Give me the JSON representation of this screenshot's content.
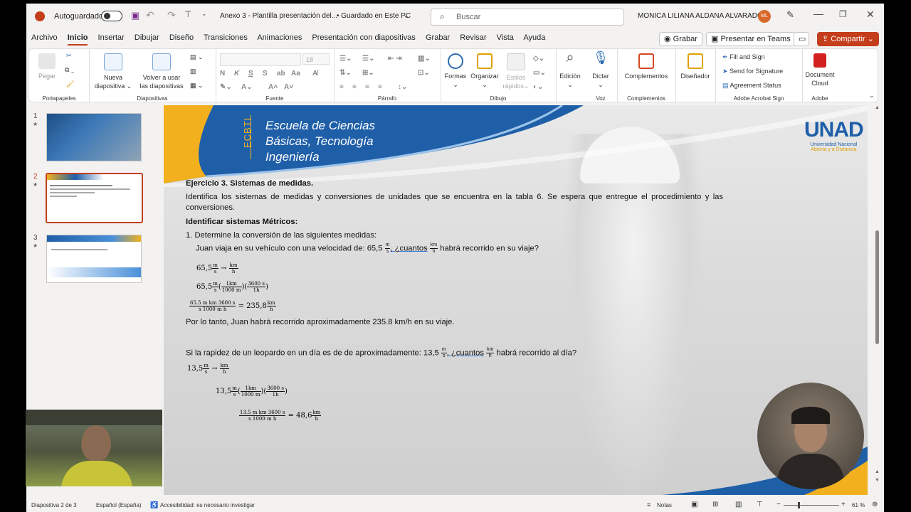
{
  "titlebar": {
    "autosave_label": "Autoguardado",
    "doc_title": "Anexo 3 - Plantilla presentación del...",
    "save_state": "• Guardado en Este PC",
    "search_placeholder": "Buscar",
    "user_name": "MONICA LILIANA ALDANA ALVARADO",
    "user_initials": "ML"
  },
  "menu": {
    "items": [
      "Archivo",
      "Inicio",
      "Insertar",
      "Dibujar",
      "Diseño",
      "Transiciones",
      "Animaciones",
      "Presentación con diapositivas",
      "Grabar",
      "Revisar",
      "Vista",
      "Ayuda"
    ],
    "record": "Grabar",
    "teams": "Presentar en Teams",
    "share": "Compartir"
  },
  "ribbon": {
    "paste": "Pegar",
    "new_slide": [
      "Nueva",
      "diapositiva"
    ],
    "reuse": [
      "Volver a usar",
      "las diapositivas"
    ],
    "font_size": "18",
    "shapes": "Formas",
    "arrange": "Organizar",
    "quick_styles": [
      "Estilos",
      "rápidos"
    ],
    "editing": "Edición",
    "dictate": "Dictar",
    "addins": "Complementos",
    "designer": "Diseñador",
    "fill_sign": "Fill and Sign",
    "send_sig": "Send for Signature",
    "agreement": "Agreement Status",
    "doc_cloud": [
      "Document",
      "Cloud"
    ],
    "groups": {
      "clipboard": "Portapapeles",
      "slides": "Diapositivas",
      "font": "Fuente",
      "paragraph": "Párrafo",
      "drawing": "Dibujo",
      "voice": "Voz",
      "addins": "Complementos",
      "acrobat_sign": "Adobe Acrobat Sign",
      "adobe": "Adobe"
    }
  },
  "thumbnails": [
    "1",
    "2",
    "3"
  ],
  "slide": {
    "banner": {
      "ecbti": "ECBTI",
      "line1": "Escuela de Ciencias",
      "line2": "Básicas, Tecnología",
      "line3": "Ingeniería"
    },
    "logo": {
      "mark": "UNAD",
      "line1": "Universidad Nacional",
      "line2": "Abierta y a Distancia"
    },
    "heading": "Ejercicio 3. Sistemas de medidas.",
    "intro": "Identifica los sistemas de medidas y conversiones de unidades que se encuentra en la tabla 6. Se espera que entregue el procedimiento y las conversiones.",
    "subheading": "Identificar sistemas Métricos:",
    "q1": "1.   Determine la conversión de las siguientes medidas:",
    "q1_text_a": "Juan viaja en su vehículo con una velocidad de: 65,5",
    "q1_text_b": ", ¿cuantos",
    "q1_text_c": "habrá recorrido en su viaje?",
    "v1": "65,5",
    "r1": "= 235,8",
    "conclusion": "Por lo tanto, Juan habrá recorrido aproximadamente 235.8 km/h en su viaje.",
    "q2_a": "Si la rapidez de un leopardo en un día es de de aproximadamente: 13,5",
    "q2_b": ", ¿cuantos",
    "q2_c": "habrá recorrido al día?",
    "v2": "13,5",
    "r2": "= 48,6",
    "u_m": "m",
    "u_s": "s",
    "u_km": "km",
    "u_h": "h",
    "u_1km": "1km",
    "u_1000m": "1000 m",
    "u_3600s": "3600 s",
    "u_1h": "1h",
    "f1_num": "65.5 m km 3600 s",
    "f1_den": "s 1000 m h",
    "f2_num": "13.5 m km 3600 s",
    "f2_den": "s 1000 m h",
    "arrow": "→"
  },
  "status": {
    "slide_info": "Diapositiva 2 de 3",
    "language": "Español (España)",
    "accessibility": "Accesibilidad: es necesario investigar",
    "notes": "Notas",
    "zoom": "61 %"
  },
  "colors": {
    "accent": "#c43e1c",
    "banner_blue": "#1f5fa8",
    "banner_gold": "#f2b01e"
  }
}
